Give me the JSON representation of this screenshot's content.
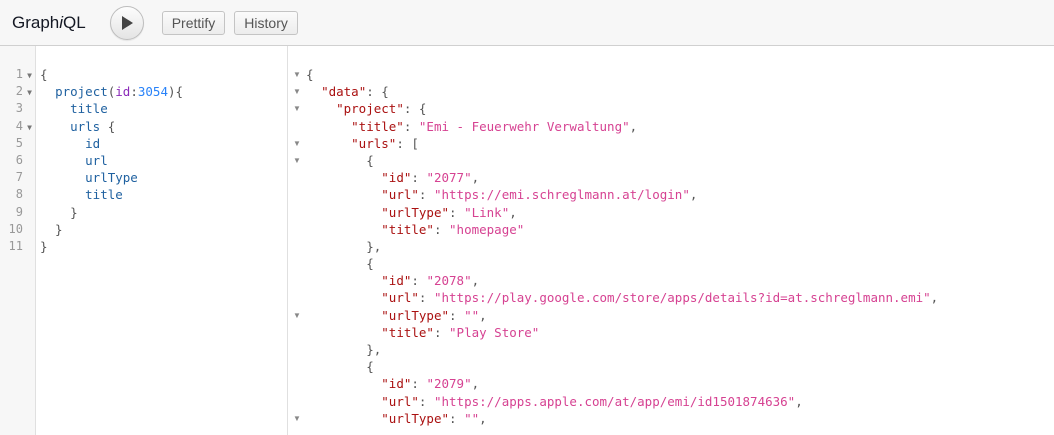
{
  "app": {
    "title_prefix": "Graph",
    "title_italic": "i",
    "title_suffix": "QL"
  },
  "toolbar": {
    "prettify_label": "Prettify",
    "history_label": "History"
  },
  "query": {
    "line_numbers": [
      "1",
      "2",
      "3",
      "4",
      "5",
      "6",
      "7",
      "8",
      "9",
      "10",
      "11"
    ],
    "fold_lines": [
      "1",
      "2",
      "4"
    ],
    "lines": [
      [
        {
          "t": "{",
          "c": "punc"
        }
      ],
      [
        {
          "t": "  ",
          "c": "def"
        },
        {
          "t": "project",
          "c": "field"
        },
        {
          "t": "(",
          "c": "punc"
        },
        {
          "t": "id",
          "c": "arg"
        },
        {
          "t": ":",
          "c": "punc"
        },
        {
          "t": "3054",
          "c": "num"
        },
        {
          "t": "){",
          "c": "punc"
        }
      ],
      [
        {
          "t": "    ",
          "c": "def"
        },
        {
          "t": "title",
          "c": "field"
        }
      ],
      [
        {
          "t": "    ",
          "c": "def"
        },
        {
          "t": "urls",
          "c": "field"
        },
        {
          "t": " {",
          "c": "punc"
        }
      ],
      [
        {
          "t": "      ",
          "c": "def"
        },
        {
          "t": "id",
          "c": "field"
        }
      ],
      [
        {
          "t": "      ",
          "c": "def"
        },
        {
          "t": "url",
          "c": "field"
        }
      ],
      [
        {
          "t": "      ",
          "c": "def"
        },
        {
          "t": "urlType",
          "c": "field"
        }
      ],
      [
        {
          "t": "      ",
          "c": "def"
        },
        {
          "t": "title",
          "c": "field"
        }
      ],
      [
        {
          "t": "    }",
          "c": "punc"
        }
      ],
      [
        {
          "t": "  }",
          "c": "punc"
        }
      ],
      [
        {
          "t": "}",
          "c": "punc"
        }
      ]
    ]
  },
  "result": {
    "fold_rows": [
      0,
      1,
      2,
      4,
      5,
      14,
      20
    ],
    "lines": [
      [
        {
          "t": "{",
          "c": "punc"
        }
      ],
      [
        {
          "t": "  ",
          "c": "def"
        },
        {
          "t": "\"data\"",
          "c": "key"
        },
        {
          "t": ": {",
          "c": "punc"
        }
      ],
      [
        {
          "t": "    ",
          "c": "def"
        },
        {
          "t": "\"project\"",
          "c": "key"
        },
        {
          "t": ": {",
          "c": "punc"
        }
      ],
      [
        {
          "t": "      ",
          "c": "def"
        },
        {
          "t": "\"title\"",
          "c": "key"
        },
        {
          "t": ": ",
          "c": "punc"
        },
        {
          "t": "\"Emi - Feuerwehr Verwaltung\"",
          "c": "str"
        },
        {
          "t": ",",
          "c": "punc"
        }
      ],
      [
        {
          "t": "      ",
          "c": "def"
        },
        {
          "t": "\"urls\"",
          "c": "key"
        },
        {
          "t": ": [",
          "c": "punc"
        }
      ],
      [
        {
          "t": "        {",
          "c": "punc"
        }
      ],
      [
        {
          "t": "          ",
          "c": "def"
        },
        {
          "t": "\"id\"",
          "c": "key"
        },
        {
          "t": ": ",
          "c": "punc"
        },
        {
          "t": "\"2077\"",
          "c": "str"
        },
        {
          "t": ",",
          "c": "punc"
        }
      ],
      [
        {
          "t": "          ",
          "c": "def"
        },
        {
          "t": "\"url\"",
          "c": "key"
        },
        {
          "t": ": ",
          "c": "punc"
        },
        {
          "t": "\"https://emi.schreglmann.at/login\"",
          "c": "str"
        },
        {
          "t": ",",
          "c": "punc"
        }
      ],
      [
        {
          "t": "          ",
          "c": "def"
        },
        {
          "t": "\"urlType\"",
          "c": "key"
        },
        {
          "t": ": ",
          "c": "punc"
        },
        {
          "t": "\"Link\"",
          "c": "str"
        },
        {
          "t": ",",
          "c": "punc"
        }
      ],
      [
        {
          "t": "          ",
          "c": "def"
        },
        {
          "t": "\"title\"",
          "c": "key"
        },
        {
          "t": ": ",
          "c": "punc"
        },
        {
          "t": "\"homepage\"",
          "c": "str"
        }
      ],
      [
        {
          "t": "        },",
          "c": "punc"
        }
      ],
      [
        {
          "t": "        {",
          "c": "punc"
        }
      ],
      [
        {
          "t": "          ",
          "c": "def"
        },
        {
          "t": "\"id\"",
          "c": "key"
        },
        {
          "t": ": ",
          "c": "punc"
        },
        {
          "t": "\"2078\"",
          "c": "str"
        },
        {
          "t": ",",
          "c": "punc"
        }
      ],
      [
        {
          "t": "          ",
          "c": "def"
        },
        {
          "t": "\"url\"",
          "c": "key"
        },
        {
          "t": ": ",
          "c": "punc"
        },
        {
          "t": "\"https://play.google.com/store/apps/details?id=at.schreglmann.emi\"",
          "c": "str"
        },
        {
          "t": ",",
          "c": "punc"
        }
      ],
      [
        {
          "t": "          ",
          "c": "def"
        },
        {
          "t": "\"urlType\"",
          "c": "key"
        },
        {
          "t": ": ",
          "c": "punc"
        },
        {
          "t": "\"\"",
          "c": "str"
        },
        {
          "t": ",",
          "c": "punc"
        }
      ],
      [
        {
          "t": "          ",
          "c": "def"
        },
        {
          "t": "\"title\"",
          "c": "key"
        },
        {
          "t": ": ",
          "c": "punc"
        },
        {
          "t": "\"Play Store\"",
          "c": "str"
        }
      ],
      [
        {
          "t": "        },",
          "c": "punc"
        }
      ],
      [
        {
          "t": "        {",
          "c": "punc"
        }
      ],
      [
        {
          "t": "          ",
          "c": "def"
        },
        {
          "t": "\"id\"",
          "c": "key"
        },
        {
          "t": ": ",
          "c": "punc"
        },
        {
          "t": "\"2079\"",
          "c": "str"
        },
        {
          "t": ",",
          "c": "punc"
        }
      ],
      [
        {
          "t": "          ",
          "c": "def"
        },
        {
          "t": "\"url\"",
          "c": "key"
        },
        {
          "t": ": ",
          "c": "punc"
        },
        {
          "t": "\"https://apps.apple.com/at/app/emi/id1501874636\"",
          "c": "str"
        },
        {
          "t": ",",
          "c": "punc"
        }
      ],
      [
        {
          "t": "          ",
          "c": "def"
        },
        {
          "t": "\"urlType\"",
          "c": "key"
        },
        {
          "t": ": ",
          "c": "punc"
        },
        {
          "t": "\"\"",
          "c": "str"
        },
        {
          "t": ",",
          "c": "punc"
        }
      ]
    ]
  },
  "colors": {
    "field": "#1f61a0",
    "arg": "#8b2bb9",
    "number": "#2882f9",
    "key": "#aa1111",
    "string": "#d64292",
    "punctuation": "#555555"
  },
  "icons": {
    "run": "play-icon",
    "fold": "fold-triangle-icon"
  }
}
